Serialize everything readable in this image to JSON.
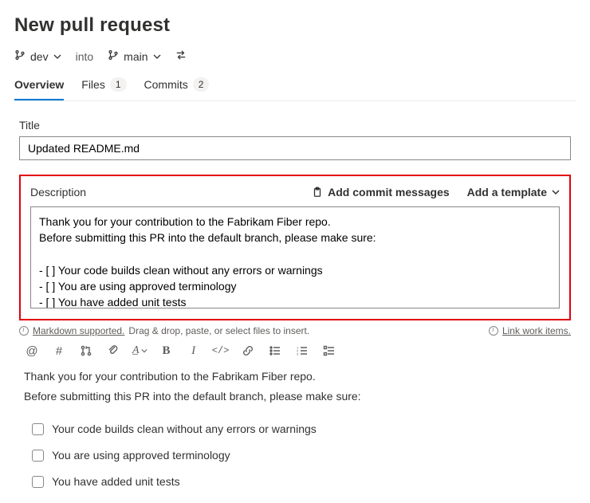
{
  "page_title": "New pull request",
  "branches": {
    "source": "dev",
    "into_label": "into",
    "target": "main"
  },
  "tabs": [
    {
      "label": "Overview",
      "count": null,
      "active": true
    },
    {
      "label": "Files",
      "count": "1",
      "active": false
    },
    {
      "label": "Commits",
      "count": "2",
      "active": false
    }
  ],
  "title_field": {
    "label": "Title",
    "value": "Updated README.md"
  },
  "description": {
    "label": "Description",
    "add_commit_messages": "Add commit messages",
    "add_template": "Add a template",
    "value": "Thank you for your contribution to the Fabrikam Fiber repo.\nBefore submitting this PR into the default branch, please make sure:\n\n- [ ] Your code builds clean without any errors or warnings\n- [ ] You are using approved terminology\n- [ ] You have added unit tests"
  },
  "hints": {
    "markdown_supported": "Markdown supported.",
    "drag_drop": "Drag & drop, paste, or select files to insert.",
    "link_work_items": "Link work items."
  },
  "preview": {
    "line1": "Thank you for your contribution to the Fabrikam Fiber repo.",
    "line2": "Before submitting this PR into the default branch, please make sure:",
    "items": [
      "Your code builds clean without any errors or warnings",
      "You are using approved terminology",
      "You have added unit tests"
    ]
  }
}
